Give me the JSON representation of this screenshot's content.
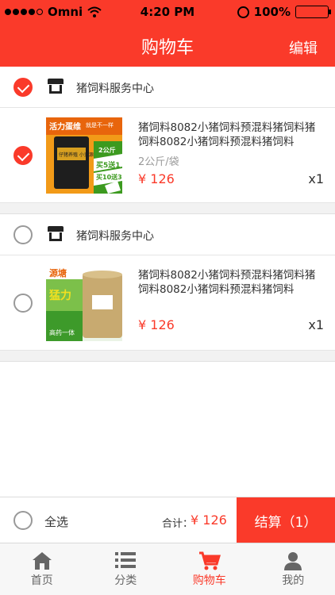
{
  "status_bar": {
    "carrier": "Omni",
    "time": "4:20 PM",
    "battery": "100%"
  },
  "nav": {
    "title": "购物车",
    "edit_label": "编辑"
  },
  "cart": {
    "groups": [
      {
        "shop_name": "猪饲料服务中心",
        "checked": true,
        "item": {
          "title": "猪饲料8082小猪饲料预混料猪饲料猪饲料8082小猪饲料预混料猪饲料",
          "spec": "2公斤/袋",
          "price": "¥ 126",
          "qty": "x1",
          "checked": true,
          "image_text": {
            "top": "活力蛋维",
            "top_right": "就是不一样",
            "mid": "仔猪养殖 小资源",
            "badge": "2公斤",
            "promo1": "买5送1",
            "promo2": "买10送3"
          }
        }
      },
      {
        "shop_name": "猪饲料服务中心",
        "checked": false,
        "item": {
          "title": "猪饲料8082小猪饲料预混料猪饲料猪饲料8082小猪饲料预混料猪饲料",
          "spec": "",
          "price": "¥ 126",
          "qty": "x1",
          "checked": false,
          "image_text": {
            "top": "源塘",
            "mid": "猛力",
            "bottom": "高药一体"
          }
        }
      }
    ]
  },
  "footer": {
    "select_all": "全选",
    "total_label": "合计：",
    "total_value": "¥ 126",
    "checkout_label": "结算（1）"
  },
  "tabs": [
    {
      "label": "首页",
      "icon": "home-icon"
    },
    {
      "label": "分类",
      "icon": "list-icon"
    },
    {
      "label": "购物车",
      "icon": "cart-icon",
      "active": true
    },
    {
      "label": "我的",
      "icon": "user-icon"
    }
  ],
  "colors": {
    "accent": "#fa3a2a",
    "background": "#f2f2f2"
  }
}
